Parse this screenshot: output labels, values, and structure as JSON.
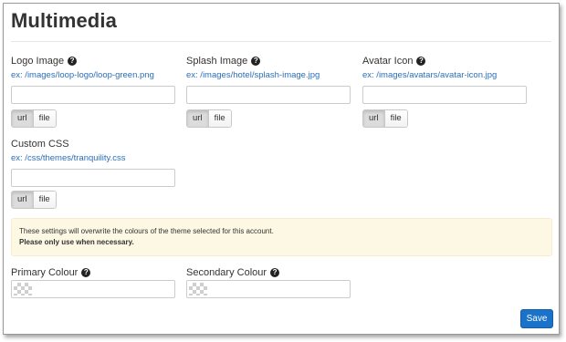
{
  "page": {
    "title": "Multimedia"
  },
  "fields": [
    {
      "label": "Logo Image",
      "hint": "ex: /images/loop-logo/loop-green.png",
      "value": ""
    },
    {
      "label": "Splash Image",
      "hint": "ex: /images/hotel/splash-image.jpg",
      "value": ""
    },
    {
      "label": "Avatar Icon",
      "hint": "ex: /images/avatars/avatar-icon.jpg",
      "value": ""
    },
    {
      "label": "Custom CSS",
      "hint": "ex: /css/themes/tranquility.css",
      "value": ""
    }
  ],
  "toggle": {
    "url_label": "url",
    "file_label": "file",
    "selected": "url"
  },
  "help_icon_glyph": "?",
  "alert": {
    "line1": "These settings will overwrite the colours of the theme selected for this account.",
    "line2": "Please only use when necessary."
  },
  "colours": [
    {
      "label": "Primary Colour",
      "value": ""
    },
    {
      "label": "Secondary Colour",
      "value": ""
    }
  ],
  "actions": {
    "save_label": "Save"
  },
  "colors": {
    "link": "#2a6ebb",
    "alert_bg": "#fcf8e3",
    "primary_button": "#1a73c9"
  }
}
